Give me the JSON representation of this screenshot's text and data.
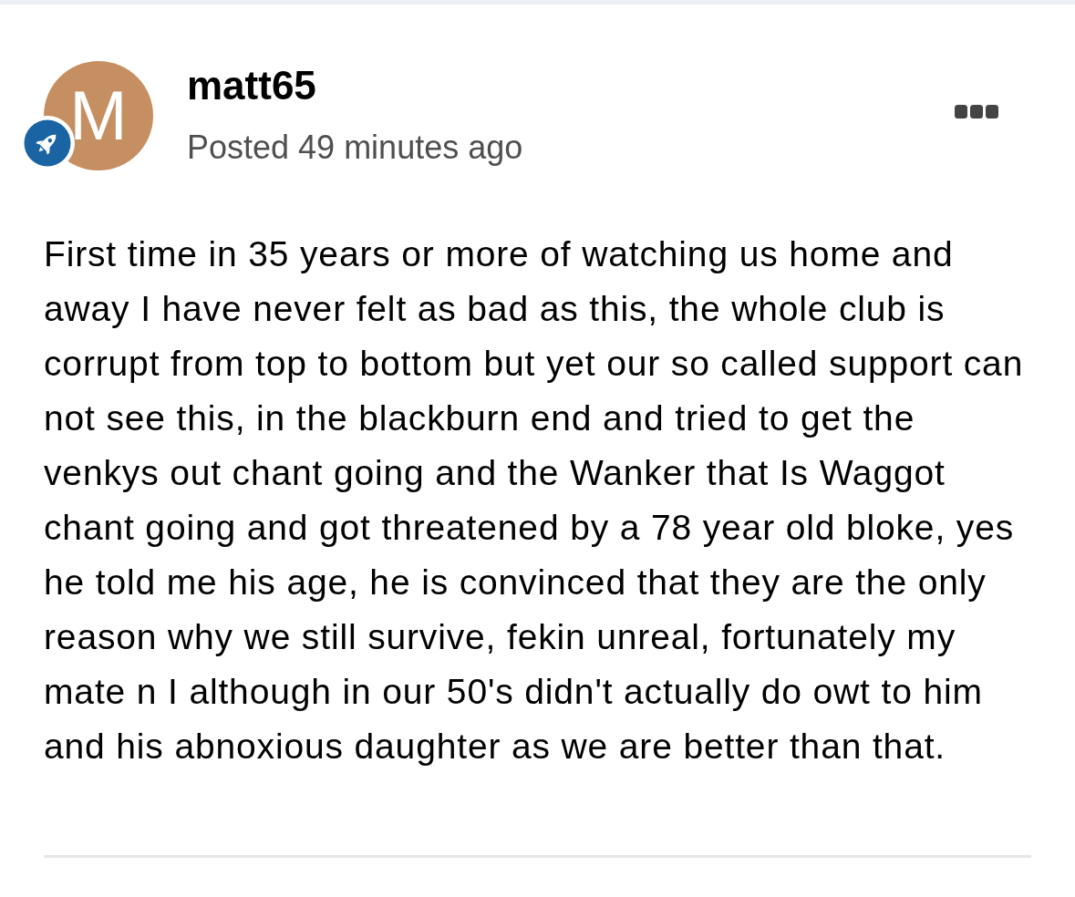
{
  "post": {
    "author": {
      "initial": "M",
      "name": "matt65"
    },
    "posted": "Posted 49 minutes ago",
    "body": "First time in 35 years or more of watching us home and away I have never felt as bad as this, the whole club is corrupt from top to bottom but yet our so called support can not see this, in the blackburn end and tried to get the venkys out chant going and the Wanker that Is Waggot chant going and got threatened by a 78 year old bloke, yes he told me his age, he is convinced that they are the only reason why we still survive, fekin unreal, fortunately my mate n I although in our 50's didn't actually do owt to him and his abnoxious daughter as we are better than that."
  }
}
